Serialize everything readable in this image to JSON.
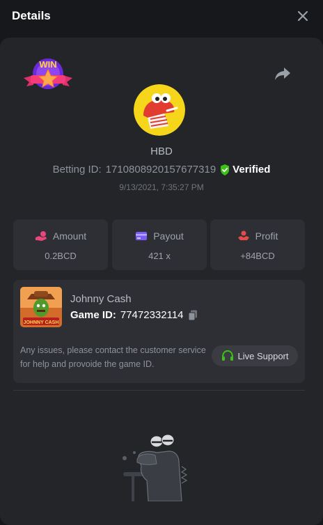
{
  "header": {
    "title": "Details"
  },
  "bet": {
    "username": "HBD",
    "betting_id_label": "Betting ID:",
    "betting_id": "1710808920157677319",
    "verified_label": "Verified",
    "datetime": "9/13/2021, 7:35:27 PM",
    "win_badge_text": "WIN"
  },
  "stats": [
    {
      "label": "Amount",
      "value": "0.2BCD",
      "icon": "hand-coin-icon"
    },
    {
      "label": "Payout",
      "value": "421 x",
      "icon": "card-icon"
    },
    {
      "label": "Profit",
      "value": "+84BCD",
      "icon": "profit-hand-icon"
    }
  ],
  "game": {
    "name": "Johnny Cash",
    "id_label": "Game ID:",
    "id": "77472332114",
    "thumb_text": "JOHNNY CASH",
    "issues_text": "Any issues, please contact the customer service for help and provoide the game ID.",
    "live_support_label": "Live Support"
  },
  "colors": {
    "accent_green": "#3bc117",
    "panel": "#232529",
    "card": "#2d2f34",
    "amount_icon": "#e8477b",
    "payout_icon": "#7b5cf0",
    "profit_icon": "#e84a4a"
  }
}
